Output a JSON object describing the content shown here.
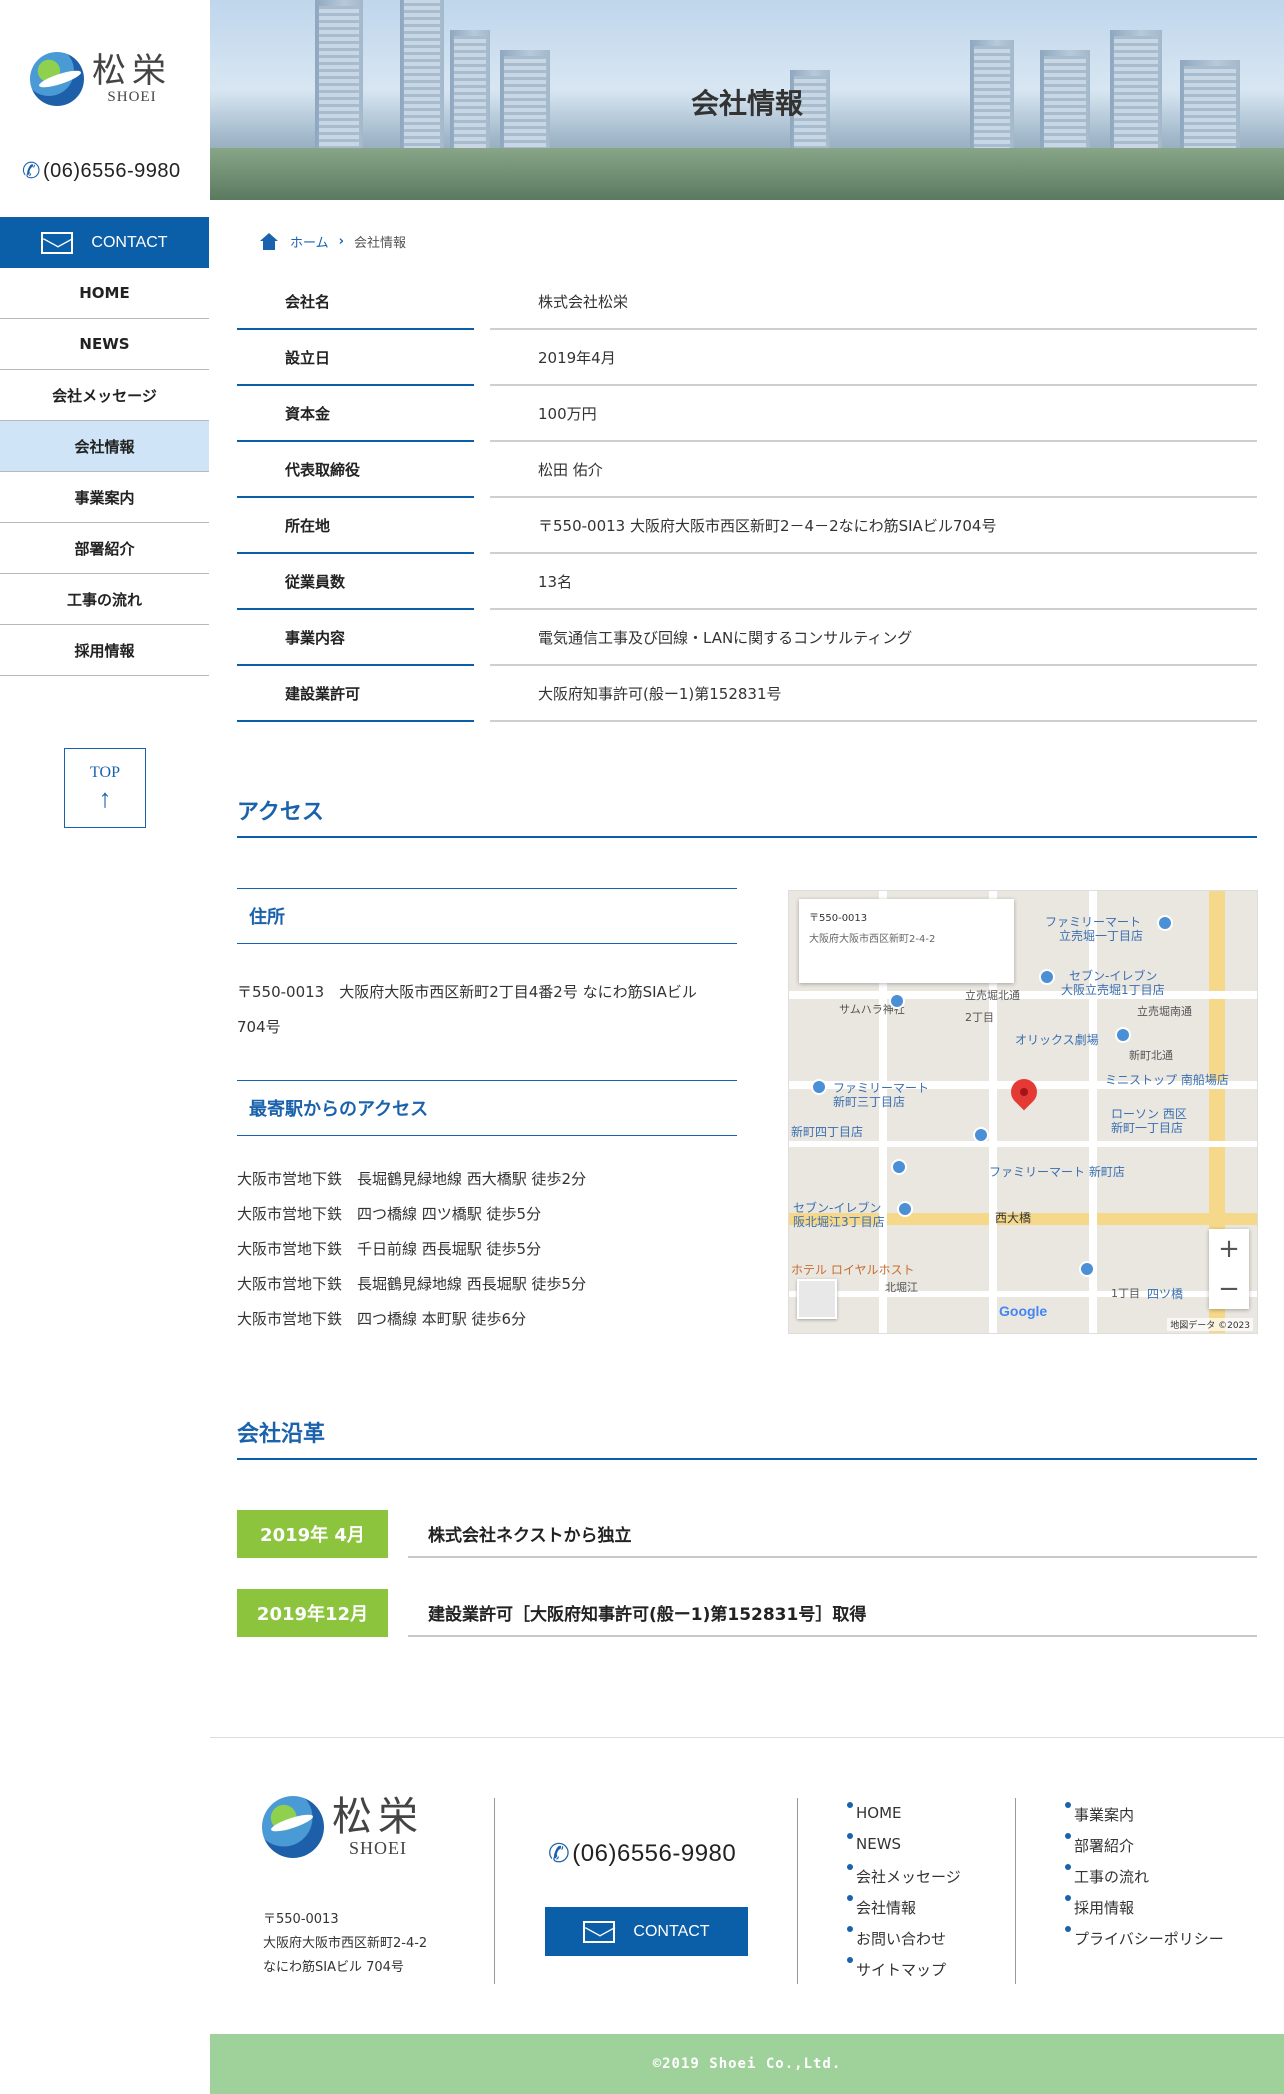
{
  "sidebar": {
    "logo_kanji": "松栄",
    "logo_roman": "SHOEI",
    "phone": "(06)6556-9980",
    "contact_label": "CONTACT",
    "nav": [
      {
        "label": "HOME"
      },
      {
        "label": "NEWS"
      },
      {
        "label": "会社メッセージ"
      },
      {
        "label": "会社情報",
        "active": true
      },
      {
        "label": "事業案内"
      },
      {
        "label": "部署紹介"
      },
      {
        "label": "工事の流れ"
      },
      {
        "label": "採用情報"
      }
    ],
    "top_label": "TOP",
    "top_arrow": "↑"
  },
  "hero": {
    "title": "会社情報"
  },
  "breadcrumb": {
    "home": "ホーム",
    "sep": "›",
    "current": "会社情報"
  },
  "company": [
    {
      "k": "会社名",
      "v": "株式会社松栄"
    },
    {
      "k": "設立日",
      "v": "2019年4月"
    },
    {
      "k": "資本金",
      "v": "100万円"
    },
    {
      "k": "代表取締役",
      "v": "松田 佑介"
    },
    {
      "k": "所在地",
      "v": "〒550-0013 大阪府大阪市西区新町2－4－2なにわ筋SIAビル704号"
    },
    {
      "k": "従業員数",
      "v": "13名"
    },
    {
      "k": "事業内容",
      "v": "電気通信工事及び回線・LANに関するコンサルティング"
    },
    {
      "k": "建設業許可",
      "v": "大阪府知事許可(般ー1)第152831号"
    }
  ],
  "access": {
    "heading": "アクセス",
    "address_heading": "住所",
    "address_line1": "〒550-0013　大阪府大阪市西区新町2丁目4番2号 なにわ筋SIAビル",
    "address_line2": "704号",
    "station_heading": "最寄駅からのアクセス",
    "stations": [
      "大阪市営地下鉄　長堀鶴見緑地線 西大橋駅 徒歩2分",
      "大阪市営地下鉄　四つ橋線 四ツ橋駅 徒歩5分",
      "大阪市営地下鉄　千日前線 西長堀駅 徒歩5分",
      "大阪市営地下鉄　長堀鶴見緑地線 西長堀駅 徒歩5分",
      "大阪市営地下鉄　四つ橋線 本町駅 徒歩6分"
    ]
  },
  "map": {
    "card_l1": "〒550-0013",
    "card_l2": "大阪府大阪市西区新町2-4-2",
    "labels": [
      "ファミリーマート",
      "立売堀一丁目店",
      "セブン-イレブン",
      "大阪立売堀1丁目店",
      "サムハラ神社",
      "オリックス劇場",
      "ミニストップ 南船場店",
      "ファミリーマート",
      "新町三丁目店",
      "ローソン 西区",
      "新町一丁目店",
      "新町四丁目店",
      "ファミリーマート 新町店",
      "セブン-イレブン",
      "阪北堀江3丁目店",
      "西大橋",
      "北堀江",
      "ホテル ロイヤルホスト",
      "立売堀北通",
      "立売堀南通",
      "新町北通",
      "2丁目",
      "1丁目",
      "四ツ橋"
    ],
    "zoom_in": "+",
    "zoom_out": "−",
    "google": "Google",
    "footer": "地図データ ©2023"
  },
  "history": {
    "heading": "会社沿革",
    "items": [
      {
        "date": "2019年 4月",
        "event": "株式会社ネクストから独立"
      },
      {
        "date": "2019年12月",
        "event": "建設業許可［大阪府知事許可(般ー1)第152831号］取得"
      }
    ]
  },
  "footer": {
    "logo_kanji": "松栄",
    "logo_roman": "SHOEI",
    "addr1": "〒550-0013",
    "addr2": "大阪府大阪市西区新町2-4-2",
    "addr3": "なにわ筋SIAビル 704号",
    "phone": "(06)6556-9980",
    "contact_label": "CONTACT",
    "links_col1": [
      "HOME",
      "NEWS",
      "会社メッセージ",
      "会社情報",
      "お問い合わせ",
      "サイトマップ"
    ],
    "links_col2": [
      "事業案内",
      "部署紹介",
      "工事の流れ",
      "採用情報",
      "プライバシーポリシー"
    ],
    "copyright": "©2019 Shoei Co.,Ltd."
  },
  "colors": {
    "primary": "#0b5ea8",
    "accent_green": "#8cc43e",
    "footer_green": "#9fd29b",
    "active_nav": "#cfe5f7"
  }
}
